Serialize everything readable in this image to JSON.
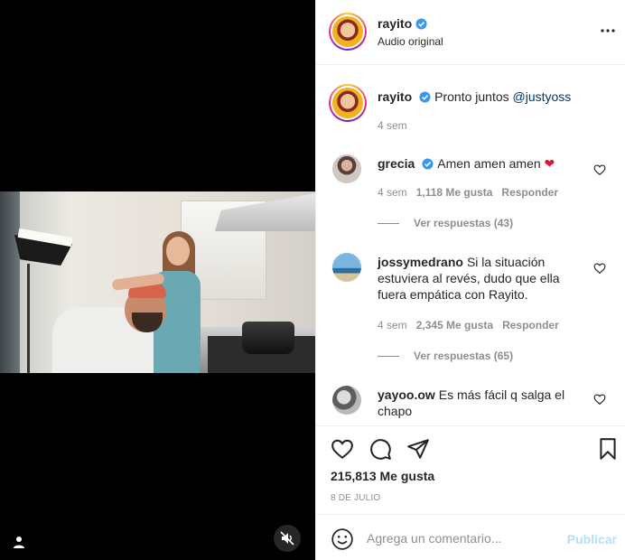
{
  "post": {
    "author": "rayito",
    "audio": "Audio original",
    "verified": true
  },
  "caption": {
    "username": "rayito",
    "text": "Pronto juntos ",
    "mention": "@justyoss",
    "time": "4 sem"
  },
  "comments": [
    {
      "username": "grecia",
      "verified": true,
      "text": "Amen amen amen ",
      "emoji": "❤",
      "time": "4 sem",
      "likes": "1,118 Me gusta",
      "reply_label": "Responder",
      "view_replies": "Ver respuestas (43)"
    },
    {
      "username": "jossymedrano",
      "verified": false,
      "text_line1": "Si la situación",
      "text_line2": "estuviera al revés, dudo que ella",
      "text_line3": "fuera empática con Rayito.",
      "time": "4 sem",
      "likes": "2,345 Me gusta",
      "reply_label": "Responder",
      "view_replies": "Ver respuestas (65)"
    },
    {
      "username": "yayoo.ow",
      "verified": false,
      "text_line1": "Es más fácil q salga el",
      "text_line2": "chapo"
    }
  ],
  "engagement": {
    "likes": "215,813 Me gusta",
    "date": "8 DE JULIO"
  },
  "composer": {
    "placeholder": "Agrega un comentario...",
    "publish_label": "Publicar"
  },
  "icons": {
    "like": "heart-icon",
    "comment": "comment-icon",
    "share": "paper-plane-icon",
    "save": "bookmark-icon",
    "more": "more-horizontal-icon",
    "emoji": "emoji-smile-icon",
    "mute": "muted-speaker-icon",
    "user_tag": "user-icon"
  },
  "colors": {
    "verified_blue": "#3897f0",
    "link": "#00376b",
    "muted_text": "#8e8e8e",
    "publish_disabled": "#b2dffc",
    "heart_red": "#ed4956"
  }
}
